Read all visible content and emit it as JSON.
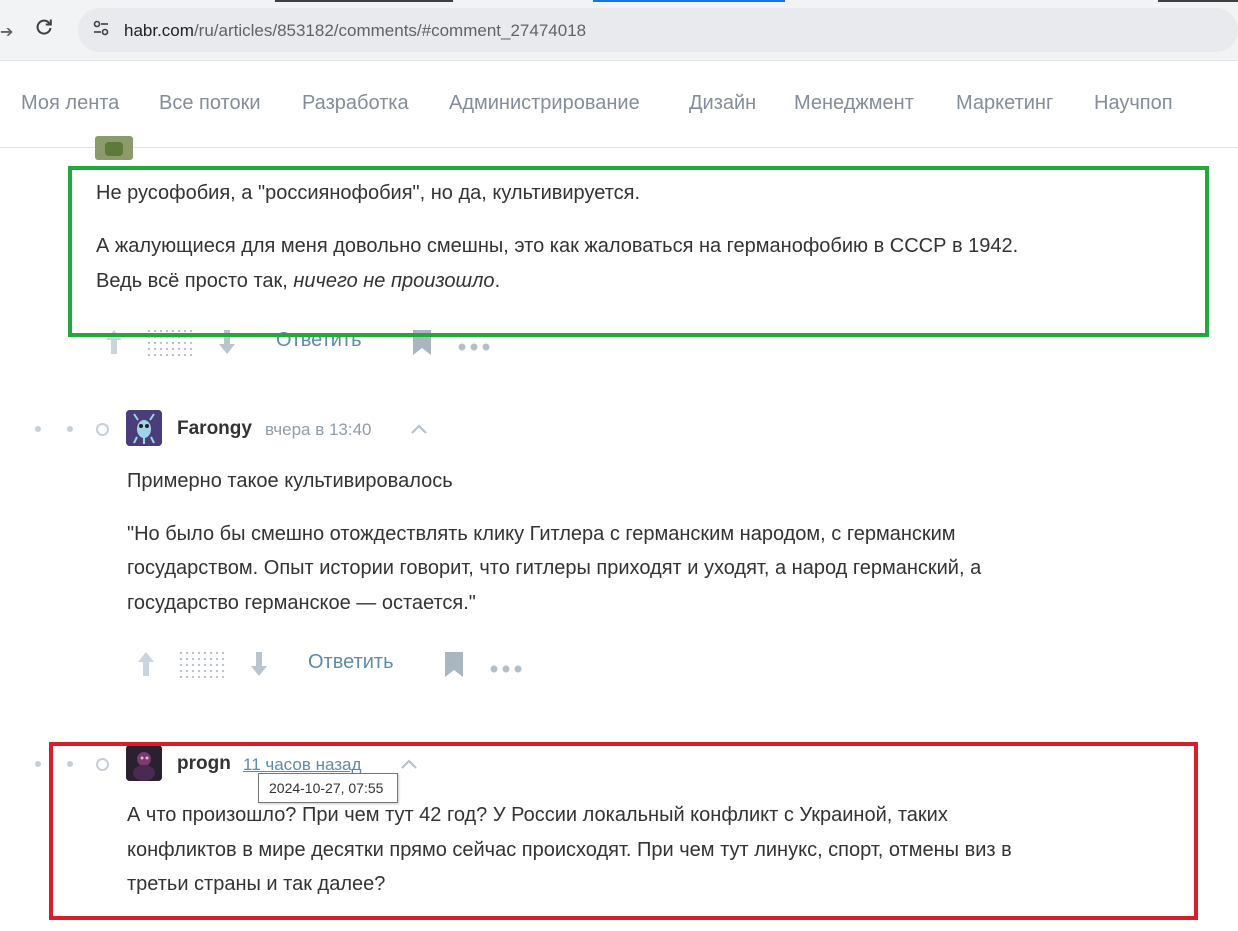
{
  "browser": {
    "url_host": "habr.com",
    "url_path": "/ru/articles/853182/comments/#comment_27474018"
  },
  "nav": {
    "items": [
      "Моя лента",
      "Все потоки",
      "Разработка",
      "Администрирование",
      "Дизайн",
      "Менеджмент",
      "Маркетинг",
      "Научпоп"
    ]
  },
  "comments": [
    {
      "paragraphs": [
        "Не русофобия, а \"россиянофобия\", но да, культивируется.",
        "А жалующиеся для меня довольно смешны, это как жаловаться на германофобию в СССР в 1942.",
        "Ведь всё просто так, ",
        "ничего не произошло",
        "."
      ],
      "reply_label": "Ответить"
    },
    {
      "author": "Farongy",
      "time": "вчера в 13:40",
      "paragraphs": [
        "Примерно такое культивировалось",
        "\"Но было бы смешно отождествлять клику Гитлера с германским народом, с германским",
        "государством. Опыт истории говорит, что гитлеры приходят и уходят, а народ германский, а",
        "государство германское — остается.\""
      ],
      "reply_label": "Ответить"
    },
    {
      "author": "progn",
      "time": "11 часов назад",
      "tooltip": "2024-10-27, 07:55",
      "paragraphs": [
        "А что произошло? При чем тут 42 год? У России локальный конфликт с Украиной, таких",
        "конфликтов в мире десятки прямо сейчас происходят. При чем тут линукс, спорт, отмены виз в",
        "третьи страны и так далее?"
      ]
    }
  ],
  "colors": {
    "highlight_green": "#23a83c",
    "highlight_red": "#d81e2b",
    "link": "#5e8ba8"
  }
}
